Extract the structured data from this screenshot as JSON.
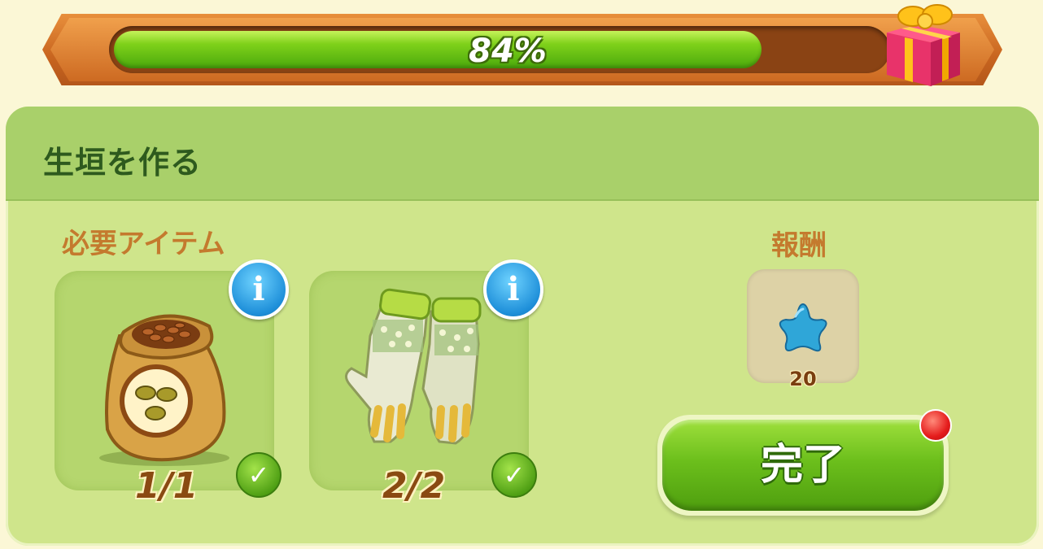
{
  "progress": {
    "percent": 84,
    "label": "84%"
  },
  "task": {
    "title": "生垣を作る"
  },
  "required_items": {
    "heading": "必要アイテム",
    "items": [
      {
        "icon": "seed-bag-icon",
        "count": "1/1",
        "complete": true
      },
      {
        "icon": "gardening-gloves-icon",
        "count": "2/2",
        "complete": true
      }
    ]
  },
  "reward": {
    "heading": "報酬",
    "icon": "blue-star-icon",
    "amount": "20"
  },
  "actions": {
    "complete_label": "完了"
  },
  "colors": {
    "progress_fill": "#7fd11a",
    "panel_bg": "#cfe58b",
    "header_bg": "#a9d06a",
    "title_text": "#2e5a1e",
    "section_label": "#c47a2e",
    "button_green": "#6cbf1c",
    "notification_red": "#e51c1c"
  }
}
